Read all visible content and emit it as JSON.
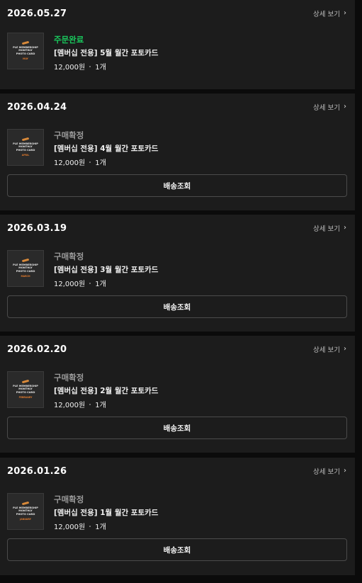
{
  "detail_label": "상세 보기",
  "ship_label": "배송조회",
  "orders": [
    {
      "date": "2026.05.27",
      "status": "주문완료",
      "status_type": "done",
      "product": "[멤버십 전용] 5월 월간 포토카드",
      "price": "12,000원",
      "qty": "1개",
      "thumb_lines": [
        "PLE MEMBERSHIP",
        "MONTHLY",
        "PHOTO CARD"
      ],
      "thumb_month": "MAY"
    },
    {
      "date": "2026.04.24",
      "status": "구매확정",
      "status_type": "confirm",
      "product": "[멤버십 전용] 4월 월간 포토카드",
      "price": "12,000원",
      "qty": "1개",
      "thumb_lines": [
        "PLE MEMBERSHIP",
        "MONTHLY",
        "PHOTO CARD"
      ],
      "thumb_month": "APRIL"
    },
    {
      "date": "2026.03.19",
      "status": "구매확정",
      "status_type": "confirm",
      "product": "[멤버십 전용] 3월 월간 포토카드",
      "price": "12,000원",
      "qty": "1개",
      "thumb_lines": [
        "PLE MEMBERSHIP",
        "MONTHLY",
        "PHOTO CARD"
      ],
      "thumb_month": "MARCH"
    },
    {
      "date": "2026.02.20",
      "status": "구매확정",
      "status_type": "confirm",
      "product": "[멤버십 전용] 2월 월간 포토카드",
      "price": "12,000원",
      "qty": "1개",
      "thumb_lines": [
        "PLE MEMBERSHIP",
        "MONTHLY",
        "PHOTO CARD"
      ],
      "thumb_month": "FEBRUARY"
    },
    {
      "date": "2026.01.26",
      "status": "구매확정",
      "status_type": "confirm",
      "product": "[멤버십 전용] 1월 월간 포토카드",
      "price": "12,000원",
      "qty": "1개",
      "thumb_lines": [
        "PLE MEMBERSHIP",
        "MONTHLY",
        "PHOTO CARD"
      ],
      "thumb_month": "JANUARY"
    }
  ]
}
